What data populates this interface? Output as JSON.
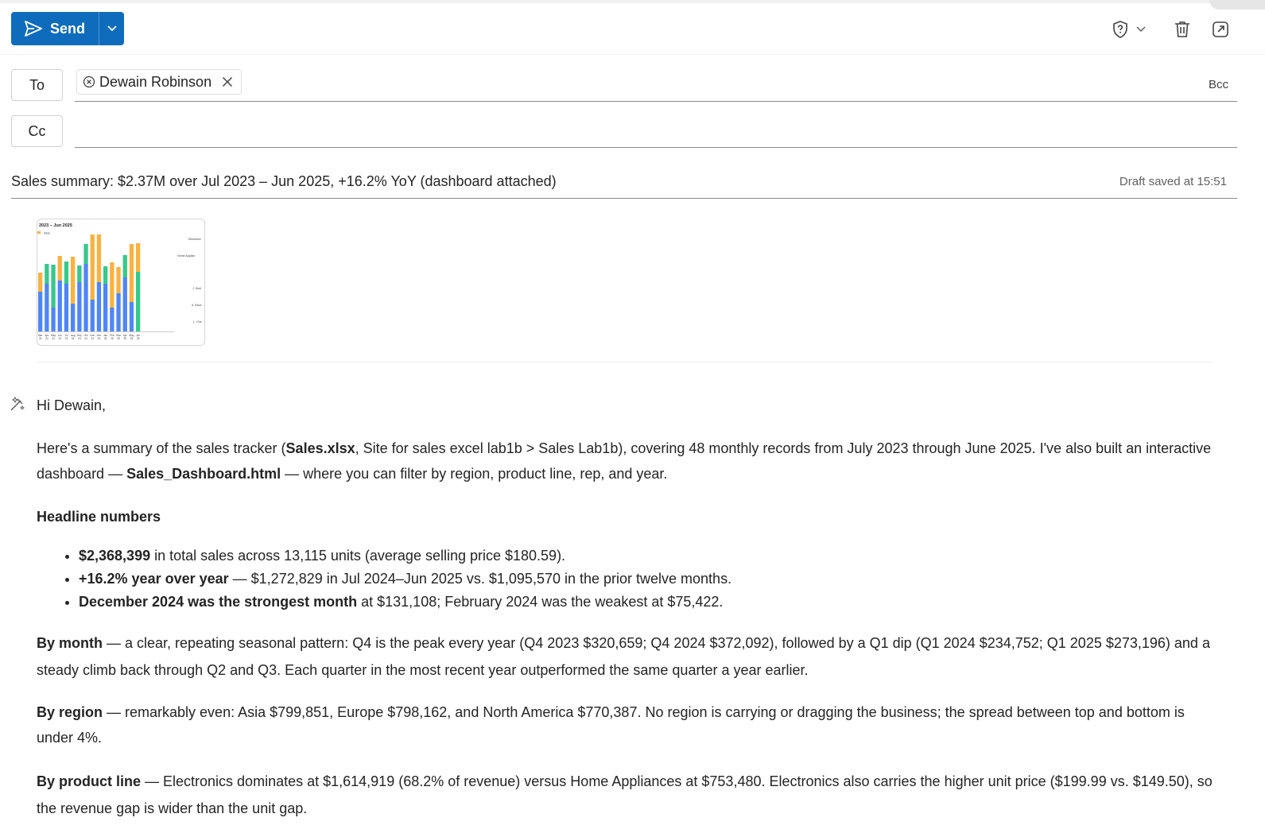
{
  "toolbar": {
    "send_label": "Send",
    "icons": [
      "send-icon",
      "chevron-down-icon",
      "shield-question-icon",
      "chevron-down-icon",
      "trash-icon",
      "pop-out-icon"
    ]
  },
  "recipients": {
    "to_label": "To",
    "cc_label": "Cc",
    "bcc_label": "Bcc",
    "to": [
      {
        "name": "Dewain Robinson"
      }
    ]
  },
  "subject": "Sales summary: $2.37M over Jul 2023 – Jun 2025, +16.2% YoY (dashboard attached)",
  "draft_status": "Draft saved at 15:51",
  "attachment": {
    "title": "2023 – Jun 2025",
    "legend_text": "Asia",
    "side_labels": [
      "Electronic",
      "Home Applian",
      "J. Smit",
      "A. Brow",
      "L. Che"
    ]
  },
  "colors": {
    "brand": "#0f6cbd",
    "chart_blue": "#4f86f7",
    "chart_green": "#36c98a",
    "chart_orange": "#f8b241"
  },
  "chart_data": {
    "type": "bar",
    "title": "2023 – Jun 2025",
    "categories": [
      "Mar 24",
      "Apr 24",
      "May 24",
      "Jun 24",
      "Jul 24",
      "Aug 24",
      "Sep 24",
      "Oct 24",
      "Nov 24",
      "Dec 24",
      "Jan 25",
      "Feb 25",
      "Mar 25",
      "Apr 25",
      "May 25",
      "Jun 25"
    ],
    "series": [
      {
        "name": "Asia",
        "values": [
          0,
          0,
          0,
          0,
          0,
          0,
          0,
          0,
          0,
          0,
          0,
          0,
          0,
          0,
          0,
          0
        ]
      },
      {
        "name": "",
        "values": [
          60,
          60,
          30,
          68,
          65,
          35,
          62,
          85,
          40,
          62,
          60,
          30,
          48,
          68,
          37,
          0
        ]
      },
      {
        "name": "",
        "values": [
          0,
          25,
          0,
          0,
          0,
          0,
          0,
          0,
          0,
          0,
          0,
          0,
          0,
          0,
          0,
          0
        ]
      },
      {
        "name": "",
        "values": [
          22,
          0,
          0,
          0,
          0,
          0,
          0,
          0,
          0,
          0,
          0,
          0,
          0,
          0,
          0,
          0
        ]
      }
    ],
    "bars": [
      {
        "blue": 0,
        "green": 0,
        "orange": 0
      },
      {
        "blue": 60,
        "green": 22,
        "orange": 0
      },
      {
        "blue": 30,
        "green": 60,
        "orange": 0
      },
      {
        "blue": 0,
        "green": 0,
        "orange": 0
      }
    ],
    "stacks": [
      {
        "b": 50,
        "g": 0,
        "o": 24
      },
      {
        "b": 60,
        "g": 25,
        "o": 0
      },
      {
        "b": 30,
        "g": 54,
        "o": 0
      },
      {
        "b": 64,
        "g": 0,
        "o": 31
      },
      {
        "b": 60,
        "g": 28,
        "o": 0
      },
      {
        "b": 35,
        "g": 0,
        "o": 59
      },
      {
        "b": 62,
        "g": 21,
        "o": 0
      },
      {
        "b": 85,
        "g": 25,
        "o": 0
      },
      {
        "b": 40,
        "g": 0,
        "o": 82
      },
      {
        "b": 62,
        "g": 0,
        "o": 60
      },
      {
        "b": 60,
        "g": 22,
        "o": 0
      },
      {
        "b": 30,
        "g": 0,
        "o": 57
      },
      {
        "b": 48,
        "g": 0,
        "o": 33
      },
      {
        "b": 68,
        "g": 28,
        "o": 0
      },
      {
        "b": 37,
        "g": 0,
        "o": 73
      },
      {
        "b": 0,
        "g": 75,
        "o": 36
      }
    ]
  },
  "body": {
    "greeting": "Hi Dewain,",
    "intro": {
      "t1": "Here's a summary of the sales tracker (",
      "b1": "Sales.xlsx",
      "t2": ", Site for sales excel lab1b > Sales Lab1b), covering 48 monthly records from July 2023 through June 2025. I've also built an interactive dashboard — ",
      "b2": "Sales_Dashboard.html",
      "t3": " — where you can filter by region, product line, rep, and year."
    },
    "headline_heading": "Headline numbers",
    "bullets": [
      {
        "bold": "$2,368,399",
        "text": " in total sales across 13,115 units (average selling price $180.59)."
      },
      {
        "bold": "+16.2% year over year",
        "text": " — $1,272,829 in Jul 2024–Jun 2025 vs. $1,095,570 in the prior twelve months."
      },
      {
        "bold": "December 2024 was the strongest month",
        "text": " at $131,108; February 2024 was the weakest at $75,422."
      }
    ],
    "by_month": {
      "bold": "By month",
      "text": " — a clear, repeating seasonal pattern: Q4 is the peak every year (Q4 2023 $320,659; Q4 2024 $372,092), followed by a Q1 dip (Q1 2024 $234,752; Q1 2025 $273,196) and a steady climb back through Q2 and Q3. Each quarter in the most recent year outperformed the same quarter a year earlier."
    },
    "by_region": {
      "bold": "By region",
      "text": " — remarkably even: Asia $799,851, Europe $798,162, and North America $770,387. No region is carrying or dragging the business; the spread between top and bottom is under 4%."
    },
    "by_product": {
      "bold": "By product line",
      "text": " — Electronics dominates at $1,614,919 (68.2% of revenue) versus Home Appliances at $753,480. Electronics also carries the higher unit price ($199.99 vs. $149.50), so the revenue gap is wider than the unit gap."
    }
  }
}
